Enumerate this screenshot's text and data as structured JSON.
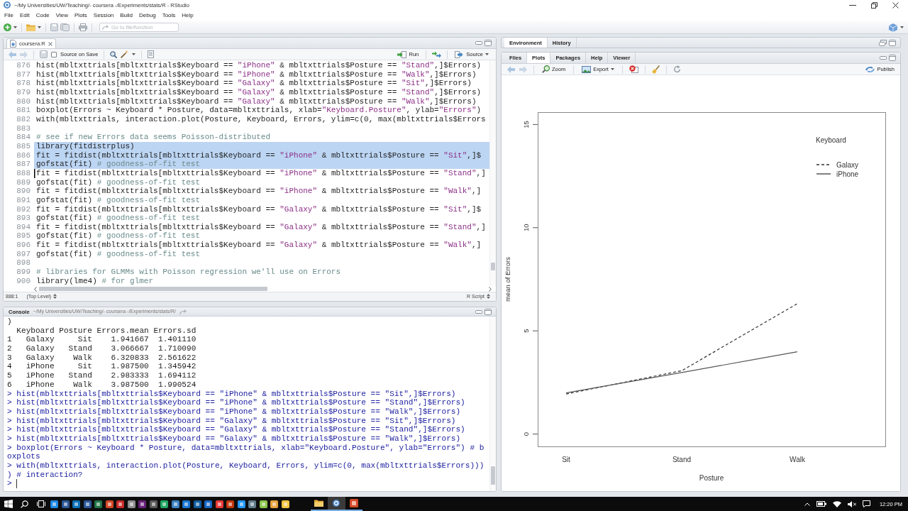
{
  "window": {
    "title": "~/My Universities/UW/Teaching/- coursera -/Experiments/stats/R - RStudio"
  },
  "menu": [
    "File",
    "Edit",
    "Code",
    "View",
    "Plots",
    "Session",
    "Build",
    "Debug",
    "Tools",
    "Help"
  ],
  "toolbar": {
    "search": {
      "placeholder": "Go to file/function"
    }
  },
  "editor": {
    "tabs": [
      {
        "label": "coursera.R",
        "selected": true
      }
    ],
    "source_on_save": {
      "label": "Source on Save",
      "checked": false
    },
    "run": "Run",
    "source": "Source",
    "lines": [
      {
        "number": "876",
        "text": "hist(mbltxttrials[mbltxttrials$Keyboard == \"iPhone\" & mbltxttrials$Posture == \"Stand\",]$Errors)",
        "selected": false,
        "cursor": false
      },
      {
        "number": "877",
        "text": "hist(mbltxttrials[mbltxttrials$Keyboard == \"iPhone\" & mbltxttrials$Posture == \"Walk\",]$Errors)",
        "selected": false,
        "cursor": false
      },
      {
        "number": "878",
        "text": "hist(mbltxttrials[mbltxttrials$Keyboard == \"Galaxy\" & mbltxttrials$Posture == \"Sit\",]$Errors)",
        "selected": false,
        "cursor": false
      },
      {
        "number": "879",
        "text": "hist(mbltxttrials[mbltxttrials$Keyboard == \"Galaxy\" & mbltxttrials$Posture == \"Stand\",]$Errors)",
        "selected": false,
        "cursor": false
      },
      {
        "number": "880",
        "text": "hist(mbltxttrials[mbltxttrials$Keyboard == \"Galaxy\" & mbltxttrials$Posture == \"Walk\",]$Errors)",
        "selected": false,
        "cursor": false
      },
      {
        "number": "881",
        "text": "boxplot(Errors ~ Keyboard * Posture, data=mbltxttrials, xlab=\"Keyboard.Posture\", ylab=\"Errors\")",
        "selected": false,
        "cursor": false
      },
      {
        "number": "882",
        "text": "with(mbltxttrials, interaction.plot(Posture, Keyboard, Errors, ylim=c(0, max(mbltxttrials$Errors",
        "selected": false,
        "cursor": false
      },
      {
        "number": "883",
        "selected": false,
        "cursor": false
      },
      {
        "number": "884",
        "text": "# see if new Errors data seems Poisson-distributed",
        "selected": false,
        "cursor": false
      },
      {
        "number": "885",
        "text": "library(fitdistrplus)",
        "selected": true,
        "cursor": false
      },
      {
        "number": "886",
        "text": "fit = fitdist(mbltxttrials[mbltxttrials$Keyboard == \"iPhone\" & mbltxttrials$Posture == \"Sit\",]$",
        "selected": true,
        "cursor": false
      },
      {
        "number": "887",
        "text": "gofstat(fit) # goodness-of-fit test",
        "selected": true,
        "cursor": false
      },
      {
        "number": "888",
        "text": "fit = fitdist(mbltxttrials[mbltxttrials$Keyboard == \"iPhone\" & mbltxttrials$Posture == \"Stand\",]",
        "selected": false,
        "cursor": true
      },
      {
        "number": "889",
        "text": "gofstat(fit) # goodness-of-fit test",
        "selected": false,
        "cursor": false
      },
      {
        "number": "890",
        "text": "fit = fitdist(mbltxttrials[mbltxttrials$Keyboard == \"iPhone\" & mbltxttrials$Posture == \"Walk\",]",
        "selected": false,
        "cursor": false
      },
      {
        "number": "891",
        "text": "gofstat(fit) # goodness-of-fit test",
        "selected": false,
        "cursor": false
      },
      {
        "number": "892",
        "text": "fit = fitdist(mbltxttrials[mbltxttrials$Keyboard == \"Galaxy\" & mbltxttrials$Posture == \"Sit\",]$",
        "selected": false,
        "cursor": false
      },
      {
        "number": "893",
        "text": "gofstat(fit) # goodness-of-fit test",
        "selected": false,
        "cursor": false
      },
      {
        "number": "894",
        "text": "fit = fitdist(mbltxttrials[mbltxttrials$Keyboard == \"Galaxy\" & mbltxttrials$Posture == \"Stand\",]",
        "selected": false,
        "cursor": false
      },
      {
        "number": "895",
        "text": "gofstat(fit) # goodness-of-fit test",
        "selected": false,
        "cursor": false
      },
      {
        "number": "896",
        "text": "fit = fitdist(mbltxttrials[mbltxttrials$Keyboard == \"Galaxy\" & mbltxttrials$Posture == \"Walk\",]",
        "selected": false,
        "cursor": false
      },
      {
        "number": "897",
        "text": "gofstat(fit) # goodness-of-fit test",
        "selected": false,
        "cursor": false
      },
      {
        "number": "898",
        "selected": false,
        "cursor": false
      },
      {
        "number": "899",
        "text": "# libraries for GLMMs with Poisson regression we'll use on Errors",
        "selected": false,
        "cursor": false
      },
      {
        "number": "900",
        "text": "library(lme4) # for glmer",
        "selected": false,
        "cursor": false
      }
    ],
    "status_bar": {
      "position": "888:1",
      "scope": "(Top Level)",
      "file_type": "R Script"
    }
  },
  "console": {
    "title": "Console",
    "path": "~/My Universities/UW/Teaching/- coursera -/Experiments/stats/R/",
    "lines": [
      {
        "kind": "output",
        "text": ")"
      },
      {
        "kind": "output",
        "text": "  Keyboard Posture Errors.mean Errors.sd"
      },
      {
        "kind": "output",
        "text": "1   Galaxy     Sit    1.941667  1.401110"
      },
      {
        "kind": "output",
        "text": "2   Galaxy   Stand    3.066667  1.710090"
      },
      {
        "kind": "output",
        "text": "3   Galaxy    Walk    6.320833  2.561622"
      },
      {
        "kind": "output",
        "text": "4   iPhone     Sit    1.987500  1.345942"
      },
      {
        "kind": "output",
        "text": "5   iPhone   Stand    2.983333  1.694112"
      },
      {
        "kind": "output",
        "text": "6   iPhone    Walk    3.987500  1.990524"
      },
      {
        "kind": "input",
        "text": "> hist(mbltxttrials[mbltxttrials$Keyboard == \"iPhone\" & mbltxttrials$Posture == \"Sit\",]$Errors)"
      },
      {
        "kind": "input",
        "text": "> hist(mbltxttrials[mbltxttrials$Keyboard == \"iPhone\" & mbltxttrials$Posture == \"Stand\",]$Errors)"
      },
      {
        "kind": "input",
        "text": "> hist(mbltxttrials[mbltxttrials$Keyboard == \"iPhone\" & mbltxttrials$Posture == \"Walk\",]$Errors)"
      },
      {
        "kind": "input",
        "text": "> hist(mbltxttrials[mbltxttrials$Keyboard == \"Galaxy\" & mbltxttrials$Posture == \"Sit\",]$Errors)"
      },
      {
        "kind": "input",
        "text": "> hist(mbltxttrials[mbltxttrials$Keyboard == \"Galaxy\" & mbltxttrials$Posture == \"Stand\",]$Errors)"
      },
      {
        "kind": "input",
        "text": "> hist(mbltxttrials[mbltxttrials$Keyboard == \"Galaxy\" & mbltxttrials$Posture == \"Walk\",]$Errors)"
      },
      {
        "kind": "input",
        "text": "> boxplot(Errors ~ Keyboard * Posture, data=mbltxttrials, xlab=\"Keyboard.Posture\", ylab=\"Errors\") # b"
      },
      {
        "kind": "input",
        "text": "oxplots"
      },
      {
        "kind": "input",
        "text": "> with(mbltxttrials, interaction.plot(Posture, Keyboard, Errors, ylim=c(0, max(mbltxttrials$Errors)))"
      },
      {
        "kind": "input",
        "text": ") # interaction?"
      },
      {
        "kind": "prompt",
        "text": ">"
      }
    ]
  },
  "environment_pane": {
    "tabs": [
      {
        "label": "Environment",
        "selected": true
      },
      {
        "label": "History",
        "selected": false
      }
    ]
  },
  "files_pane": {
    "tabs": [
      {
        "label": "Files",
        "selected": false
      },
      {
        "label": "Plots",
        "selected": true
      },
      {
        "label": "Packages",
        "selected": false
      },
      {
        "label": "Help",
        "selected": false
      },
      {
        "label": "Viewer",
        "selected": false
      }
    ],
    "zoom": "Zoom",
    "export": "Export",
    "publish": "Publish",
    "chart_data": {
      "type": "line",
      "xlabel": "Posture",
      "ylabel": "mean of Errors",
      "legend_title": "Keyboard",
      "legend": "top-right",
      "categories": [
        "Sit",
        "Stand",
        "Walk"
      ],
      "series": [
        {
          "name": "Galaxy",
          "color": "#333333",
          "line_style": "dashed",
          "values": [
            1.94,
            3.07,
            6.32
          ]
        },
        {
          "name": "iPhone",
          "color": "#555555",
          "line_style": "solid",
          "values": [
            1.99,
            2.98,
            3.99
          ]
        }
      ],
      "ylim": [
        -0.6,
        15.6
      ],
      "yticks": [
        0,
        5,
        10,
        15
      ]
    }
  },
  "taskbar": {
    "open_windows": [
      {
        "active": false
      },
      {
        "active": true
      },
      {
        "active": false
      }
    ],
    "clock": "12:20 PM"
  }
}
